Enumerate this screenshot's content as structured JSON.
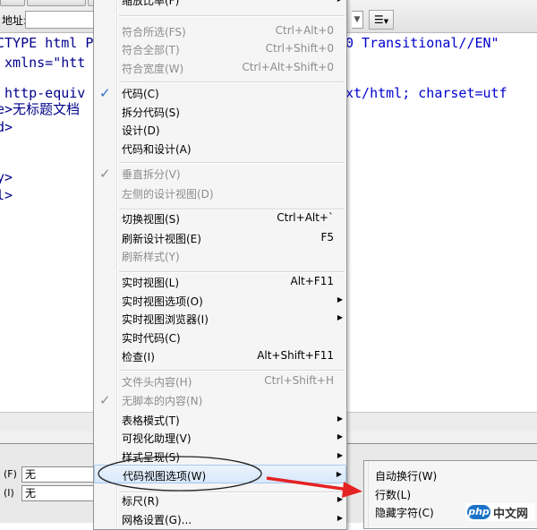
{
  "toolbar": {
    "address_label": "地址:"
  },
  "code_lines": [
    "CTYPE html P",
    " xmlns=\"htt",
    "",
    " http-equiv",
    "e>无标题文档",
    "d>",
    "",
    "",
    "y>",
    "l>"
  ],
  "code_right": {
    "line0": "0 Transitional//EN\"",
    "line3": "xt/html; charset=utf"
  },
  "props": [
    {
      "label": "(F)",
      "value": "无"
    },
    {
      "label": "(I)",
      "value": "无"
    }
  ],
  "menu": {
    "top_label": "缩放比率(F)",
    "groups": [
      [
        {
          "label": "符合所选(FS)",
          "shortcut": "Ctrl+Alt+0",
          "disabled": true
        },
        {
          "label": "符合全部(T)",
          "shortcut": "Ctrl+Shift+0",
          "disabled": true
        },
        {
          "label": "符合宽度(W)",
          "shortcut": "Ctrl+Alt+Shift+0",
          "disabled": true
        }
      ],
      [
        {
          "label": "代码(C)",
          "checked": true
        },
        {
          "label": "拆分代码(S)"
        },
        {
          "label": "设计(D)"
        },
        {
          "label": "代码和设计(A)"
        }
      ],
      [
        {
          "label": "垂直拆分(V)",
          "checked": true,
          "disabled": true
        },
        {
          "label": "左侧的设计视图(D)",
          "disabled": true
        }
      ],
      [
        {
          "label": "切换视图(S)",
          "shortcut": "Ctrl+Alt+`"
        },
        {
          "label": "刷新设计视图(E)",
          "shortcut": "F5"
        },
        {
          "label": "刷新样式(Y)",
          "disabled": true
        }
      ],
      [
        {
          "label": "实时视图(L)",
          "shortcut": "Alt+F11"
        },
        {
          "label": "实时视图选项(O)",
          "submenu": true
        },
        {
          "label": "实时视图浏览器(I)",
          "submenu": true
        },
        {
          "label": "实时代码(C)"
        },
        {
          "label": "检查(I)",
          "shortcut": "Alt+Shift+F11"
        }
      ],
      [
        {
          "label": "文件头内容(H)",
          "shortcut": "Ctrl+Shift+H",
          "disabled": true
        },
        {
          "label": "无脚本的内容(N)",
          "checked": true,
          "disabled": true
        },
        {
          "label": "表格模式(T)",
          "submenu": true
        },
        {
          "label": "可视化助理(V)",
          "submenu": true
        },
        {
          "label": "样式呈现(S)",
          "submenu": true
        }
      ],
      [
        {
          "label": "代码视图选项(W)",
          "submenu": true,
          "highlighted": true
        }
      ],
      [
        {
          "label": "标尺(R)",
          "submenu": true
        },
        {
          "label": "网格设置(G)...",
          "submenu": true
        }
      ]
    ]
  },
  "submenu": {
    "items": [
      "自动换行(W)",
      "行数(L)",
      "隐藏字符(C)"
    ]
  },
  "watermark": {
    "badge": "php",
    "text": "中文网"
  },
  "colors": {
    "annotation_red": "#e52222",
    "check_blue": "#2a6cc7",
    "code_blue": "#00008b"
  }
}
